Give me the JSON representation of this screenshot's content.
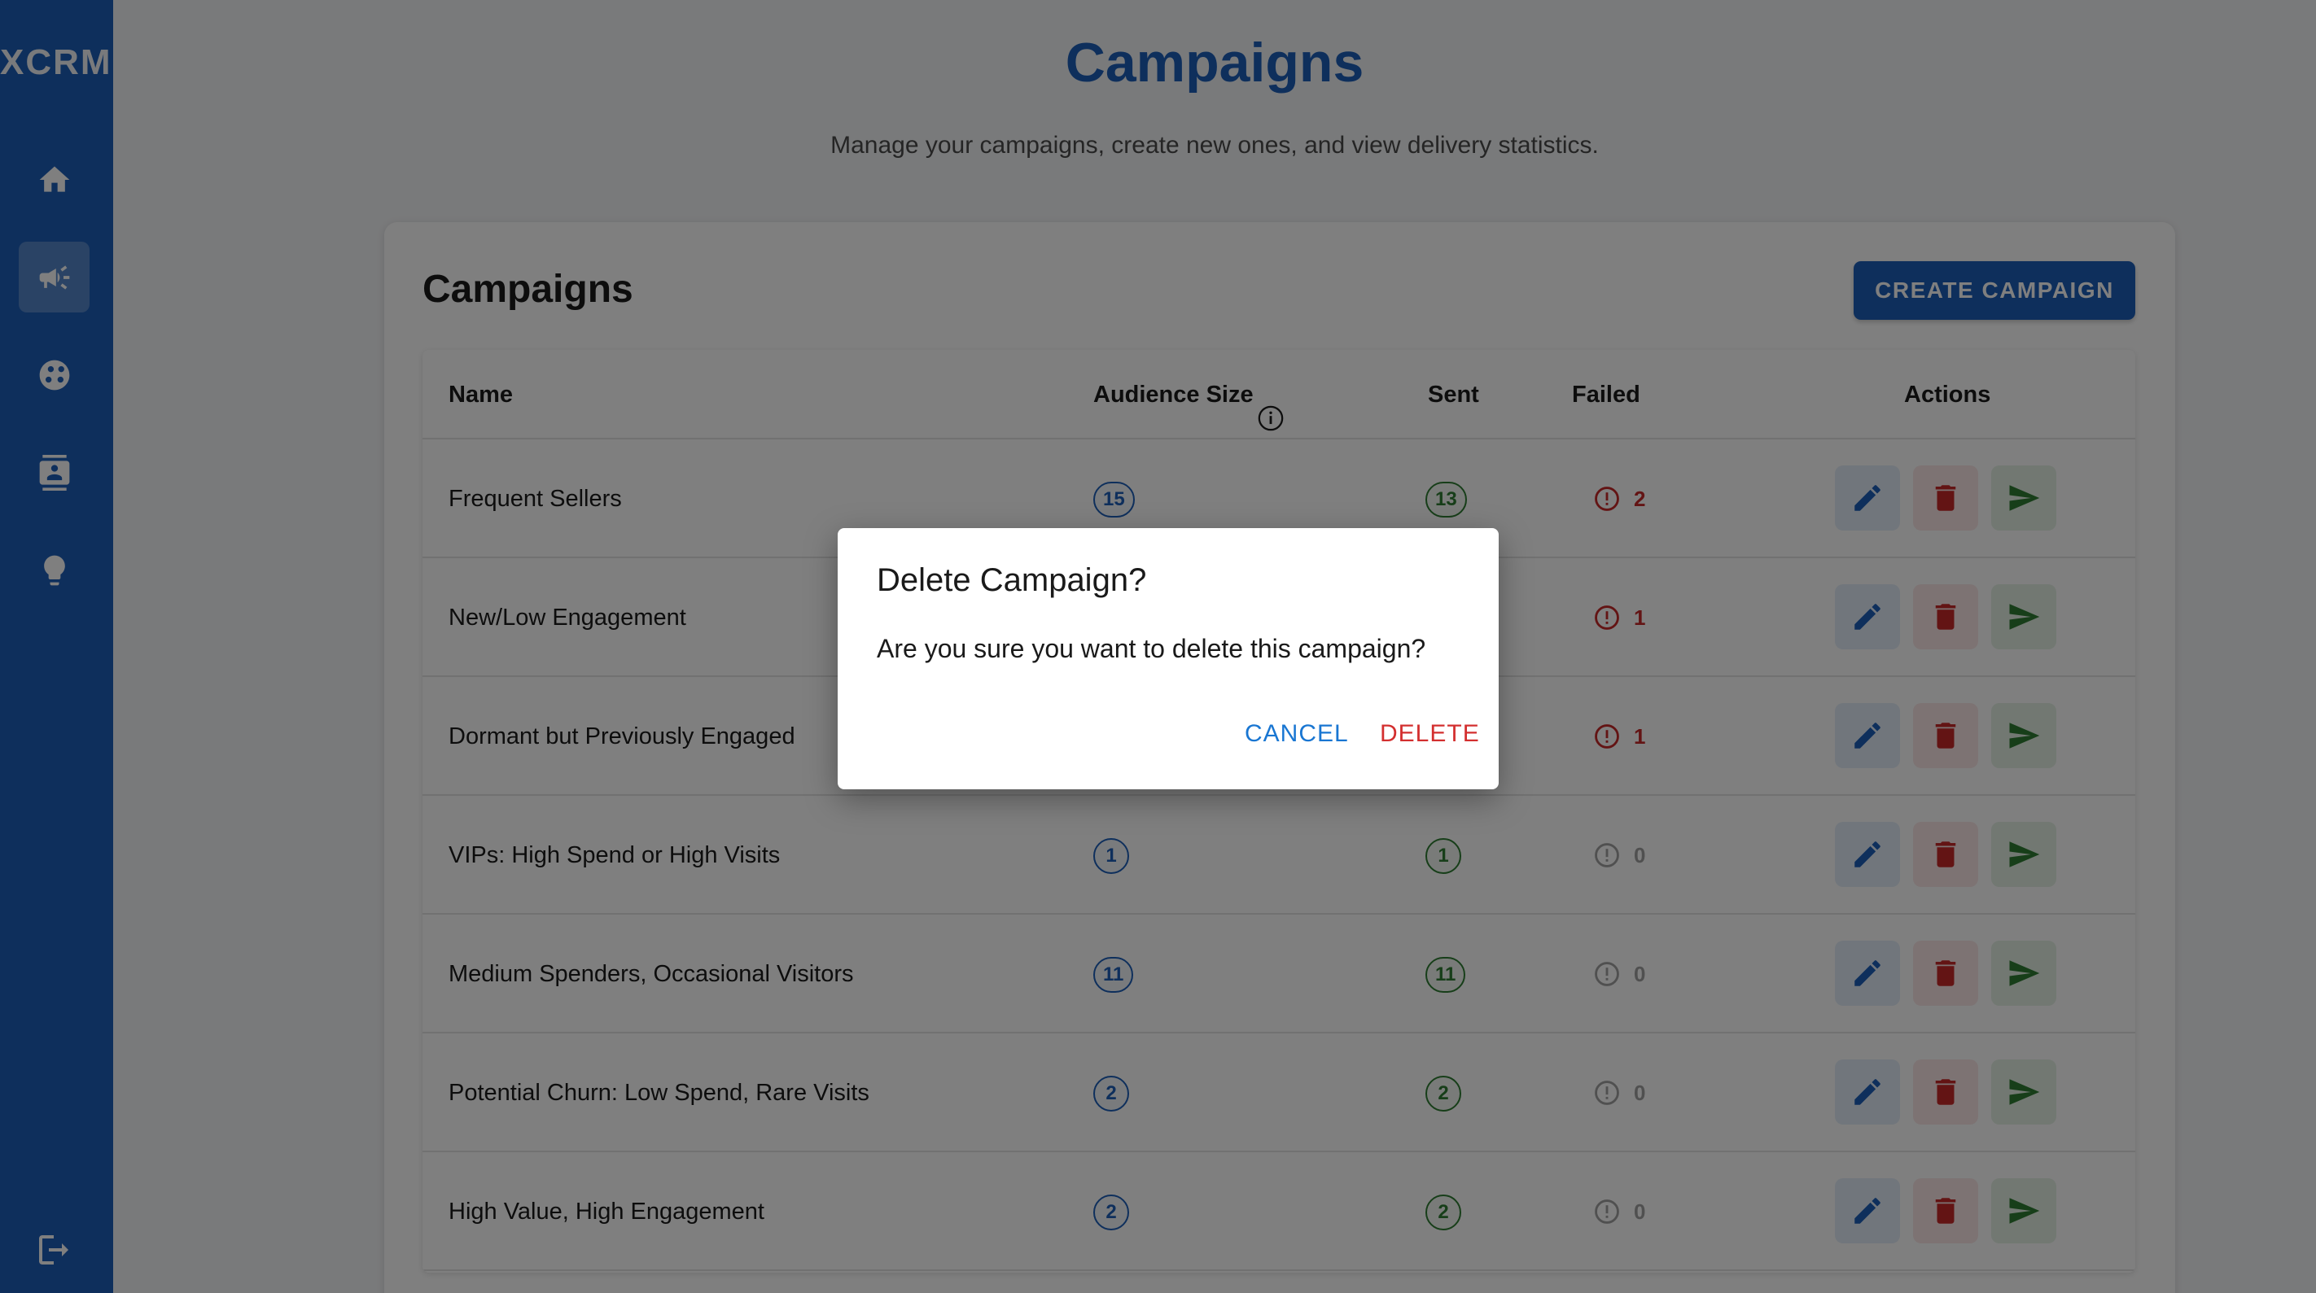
{
  "app": {
    "logo": "XCRM"
  },
  "sidebar": {
    "items": [
      {
        "icon": "home-icon",
        "active": false
      },
      {
        "icon": "megaphone-icon",
        "active": true
      },
      {
        "icon": "segments-icon",
        "active": false
      },
      {
        "icon": "contacts-icon",
        "active": false
      },
      {
        "icon": "lightbulb-icon",
        "active": false
      }
    ],
    "logout_icon": "logout-icon"
  },
  "header": {
    "title": "Campaigns",
    "subtitle": "Manage your campaigns, create new ones, and view delivery statistics."
  },
  "card": {
    "title": "Campaigns",
    "create_label": "CREATE CAMPAIGN"
  },
  "table": {
    "columns": {
      "name": "Name",
      "audience": "Audience Size",
      "sent": "Sent",
      "failed": "Failed",
      "actions": "Actions"
    },
    "rows": [
      {
        "name": "Frequent Sellers",
        "audience": "15",
        "sent": "13",
        "failed": "2"
      },
      {
        "name": "New/Low Engagement",
        "audience": "",
        "sent": "",
        "failed": "1"
      },
      {
        "name": "Dormant but Previously Engaged",
        "audience": "",
        "sent": "",
        "failed": "1"
      },
      {
        "name": "VIPs: High Spend or High Visits",
        "audience": "1",
        "sent": "1",
        "failed": "0"
      },
      {
        "name": "Medium Spenders, Occasional Visitors",
        "audience": "11",
        "sent": "11",
        "failed": "0"
      },
      {
        "name": "Potential Churn: Low Spend, Rare Visits",
        "audience": "2",
        "sent": "2",
        "failed": "0"
      },
      {
        "name": "High Value, High Engagement",
        "audience": "2",
        "sent": "2",
        "failed": "0"
      }
    ]
  },
  "dialog": {
    "title": "Delete Campaign?",
    "message": "Are you sure you want to delete this campaign?",
    "cancel_label": "CANCEL",
    "delete_label": "DELETE"
  },
  "colors": {
    "primary": "#1d5fb9",
    "success": "#2e7d32",
    "danger": "#c62828",
    "muted": "#a0a0a0"
  }
}
